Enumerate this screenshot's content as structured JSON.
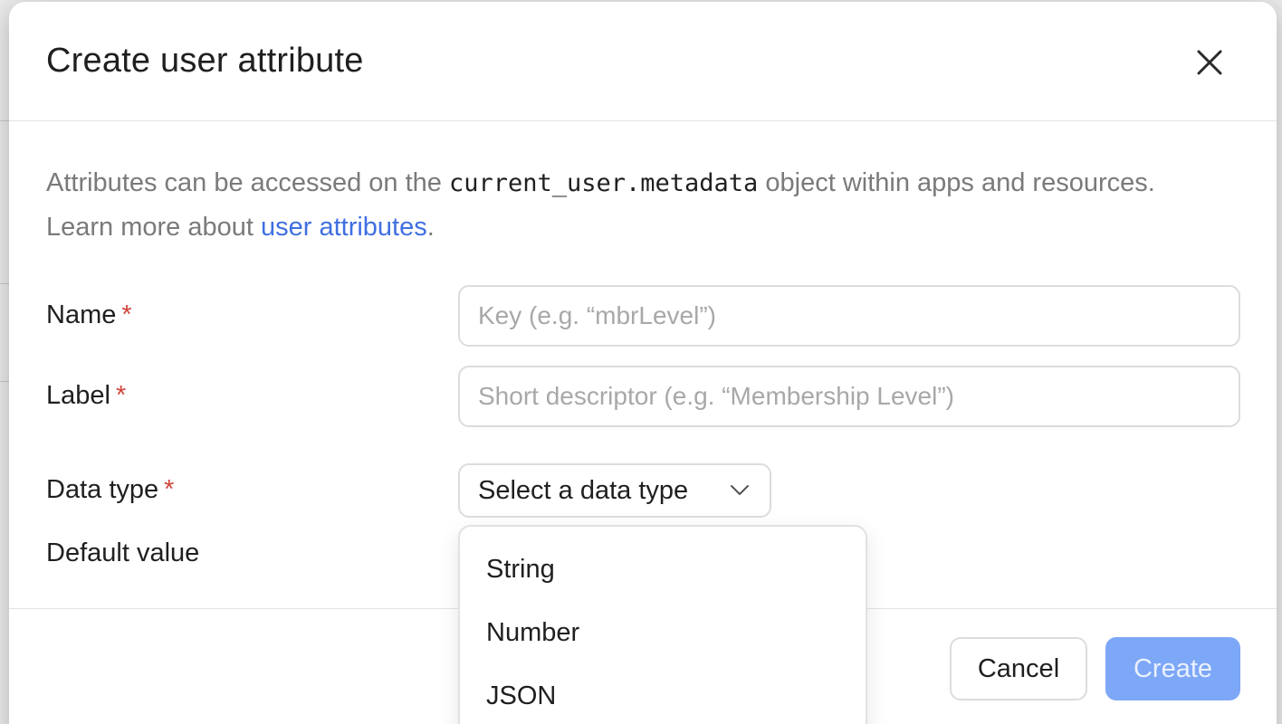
{
  "dialog": {
    "title": "Create user attribute",
    "description": {
      "prefix": "Attributes can be accessed on the ",
      "code": "current_user.metadata",
      "middle": " object within apps and resources. Learn more about ",
      "link": "user attributes",
      "suffix": "."
    },
    "fields": {
      "name": {
        "label": "Name",
        "required_mark": "*",
        "placeholder": "Key (e.g. “mbrLevel”)"
      },
      "label": {
        "label": "Label",
        "required_mark": "*",
        "placeholder": "Short descriptor (e.g. “Membership Level”)"
      },
      "data_type": {
        "label": "Data type",
        "required_mark": "*",
        "selected": "Select a data type"
      },
      "default_value": {
        "label": "Default value"
      }
    },
    "dropdown_options": [
      "String",
      "Number",
      "JSON"
    ],
    "buttons": {
      "cancel": "Cancel",
      "create": "Create"
    }
  },
  "colors": {
    "link": "#3f6fe0",
    "required": "#d0453b",
    "primary_disabled": "#7da7f7"
  },
  "icons": [
    "close-icon",
    "chevron-down-icon"
  ]
}
